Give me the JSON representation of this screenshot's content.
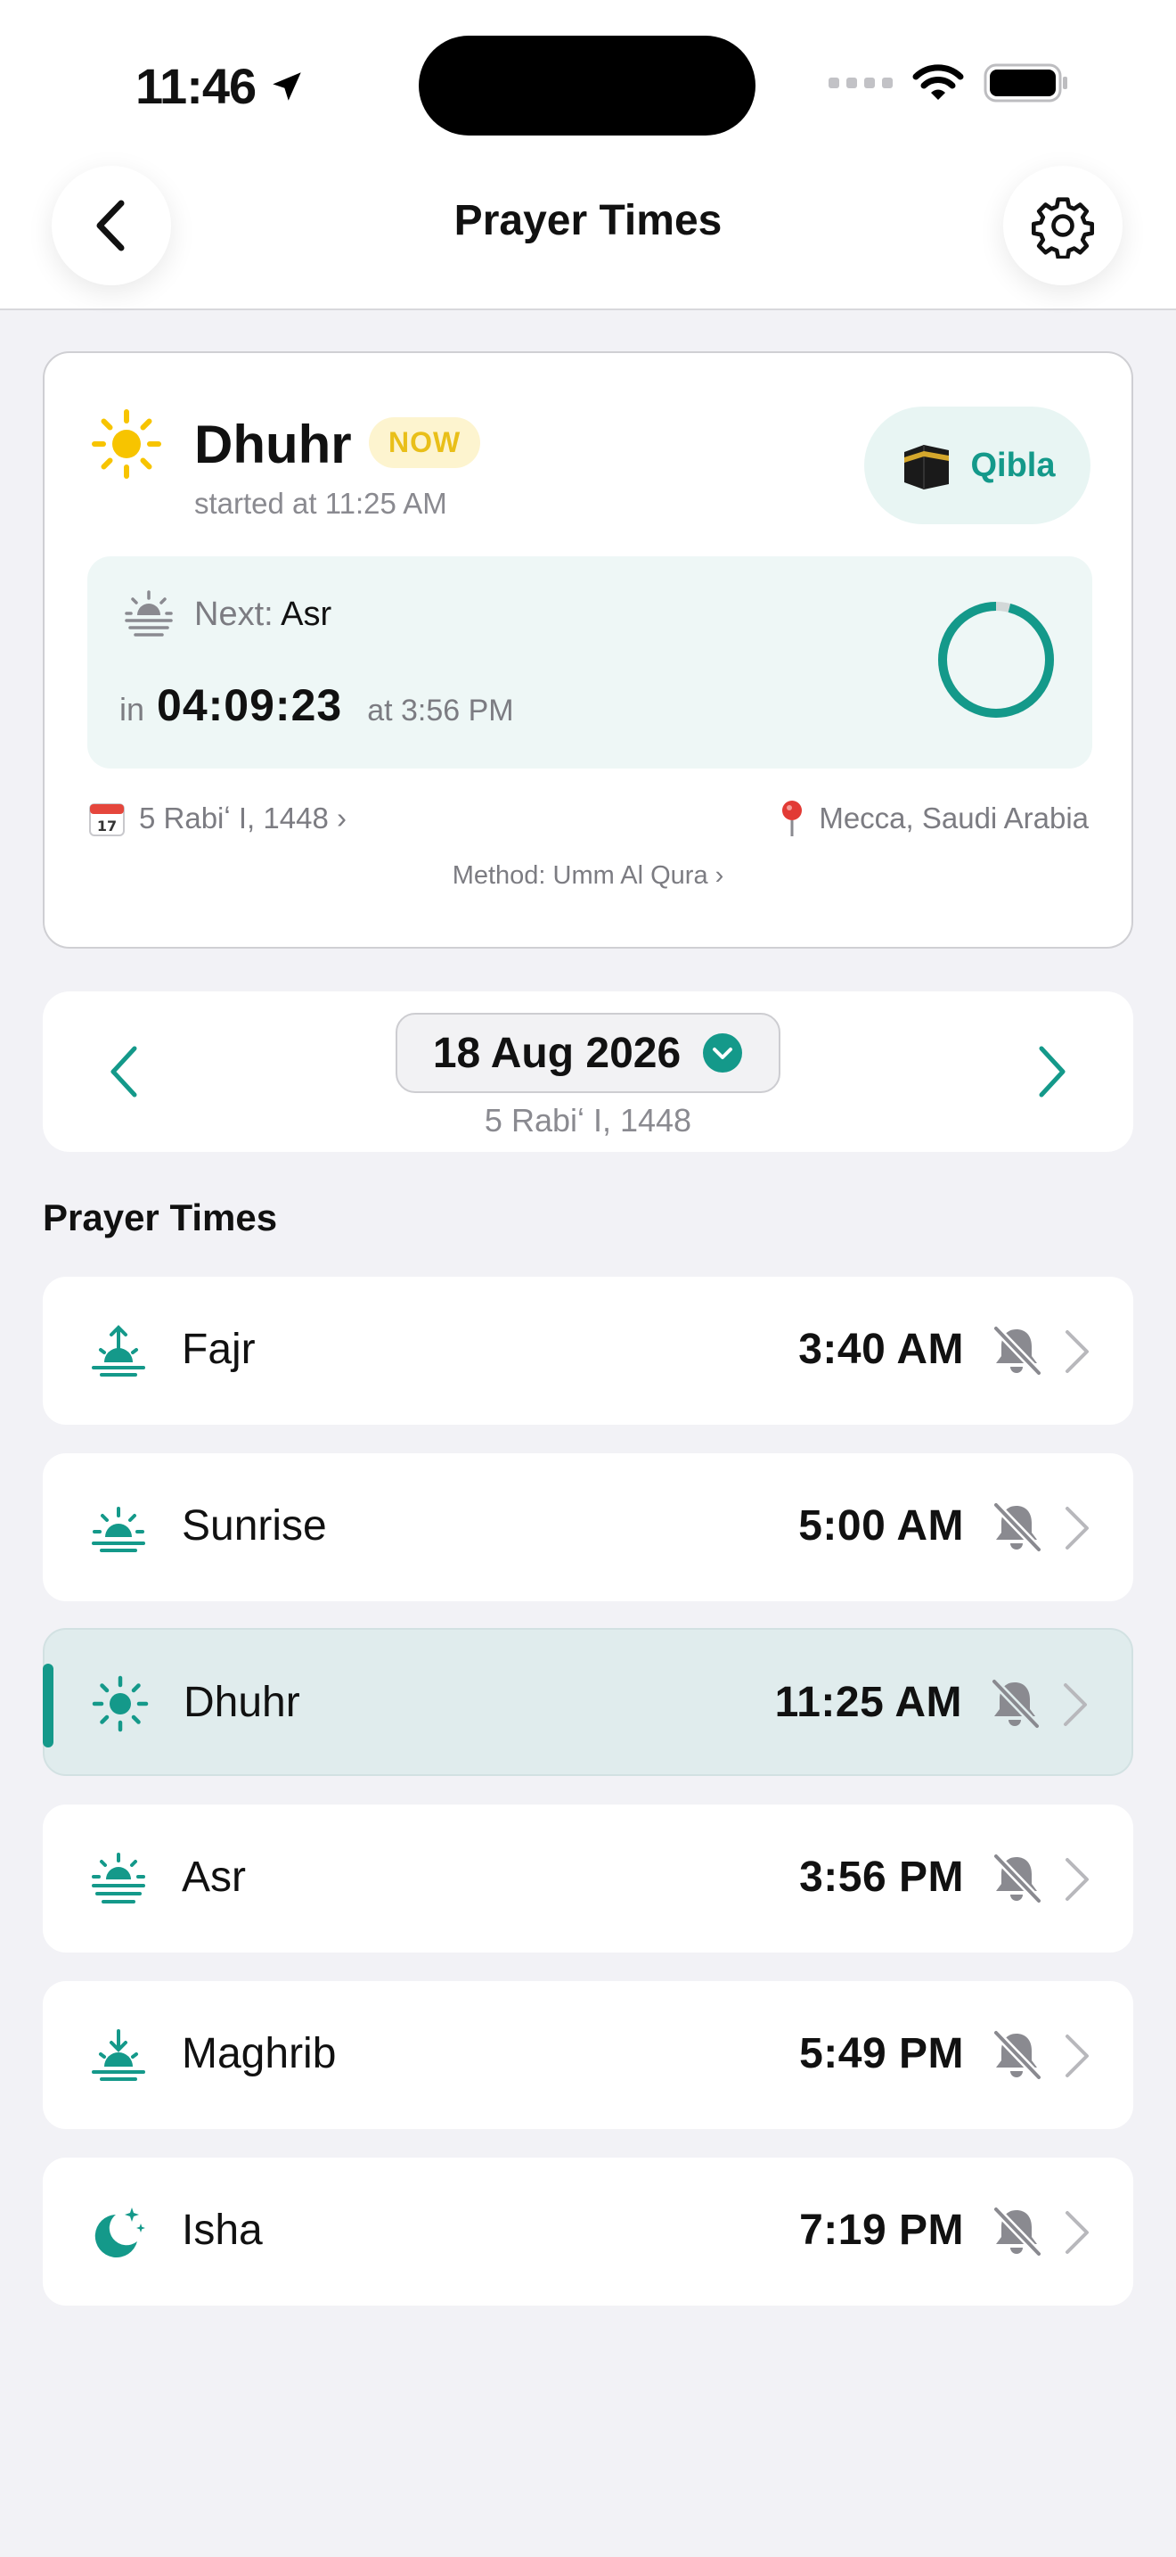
{
  "status_bar": {
    "time": "11:46"
  },
  "nav": {
    "title": "Prayer Times"
  },
  "current": {
    "name": "Dhuhr",
    "badge": "NOW",
    "started": "started at 11:25 AM",
    "qibla_label": "Qibla",
    "next_label": "Next:",
    "next_name": "Asr",
    "countdown_prefix": "in",
    "countdown": "04:09:23",
    "next_at": "at 3:56 PM",
    "progress": 0.04,
    "hijri_date": "5 Rabiʻ I, 1448 ›",
    "location": "Mecca, Saudi Arabia",
    "method": "Method: Umm Al Qura ›"
  },
  "date_picker": {
    "date": "18 Aug 2026",
    "hijri": "5 Rabiʻ I, 1448"
  },
  "section_title": "Prayer Times",
  "prayers": [
    {
      "name": "Fajr",
      "time": "3:40 AM",
      "icon": "sun-rising-icon",
      "active": false
    },
    {
      "name": "Sunrise",
      "time": "5:00 AM",
      "icon": "sunrise-icon",
      "active": false
    },
    {
      "name": "Dhuhr",
      "time": "11:25 AM",
      "icon": "sun-icon",
      "active": true
    },
    {
      "name": "Asr",
      "time": "3:56 PM",
      "icon": "sun-haze-icon",
      "active": false
    },
    {
      "name": "Maghrib",
      "time": "5:49 PM",
      "icon": "sunset-icon",
      "active": false
    },
    {
      "name": "Isha",
      "time": "7:19 PM",
      "icon": "moon-stars-icon",
      "active": false
    }
  ],
  "colors": {
    "accent": "#14998a",
    "now_badge_bg": "#fdf4cf",
    "now_badge_text": "#e9bf19",
    "active_row_bg": "#e0eced",
    "sun_yellow": "#f7c400"
  }
}
